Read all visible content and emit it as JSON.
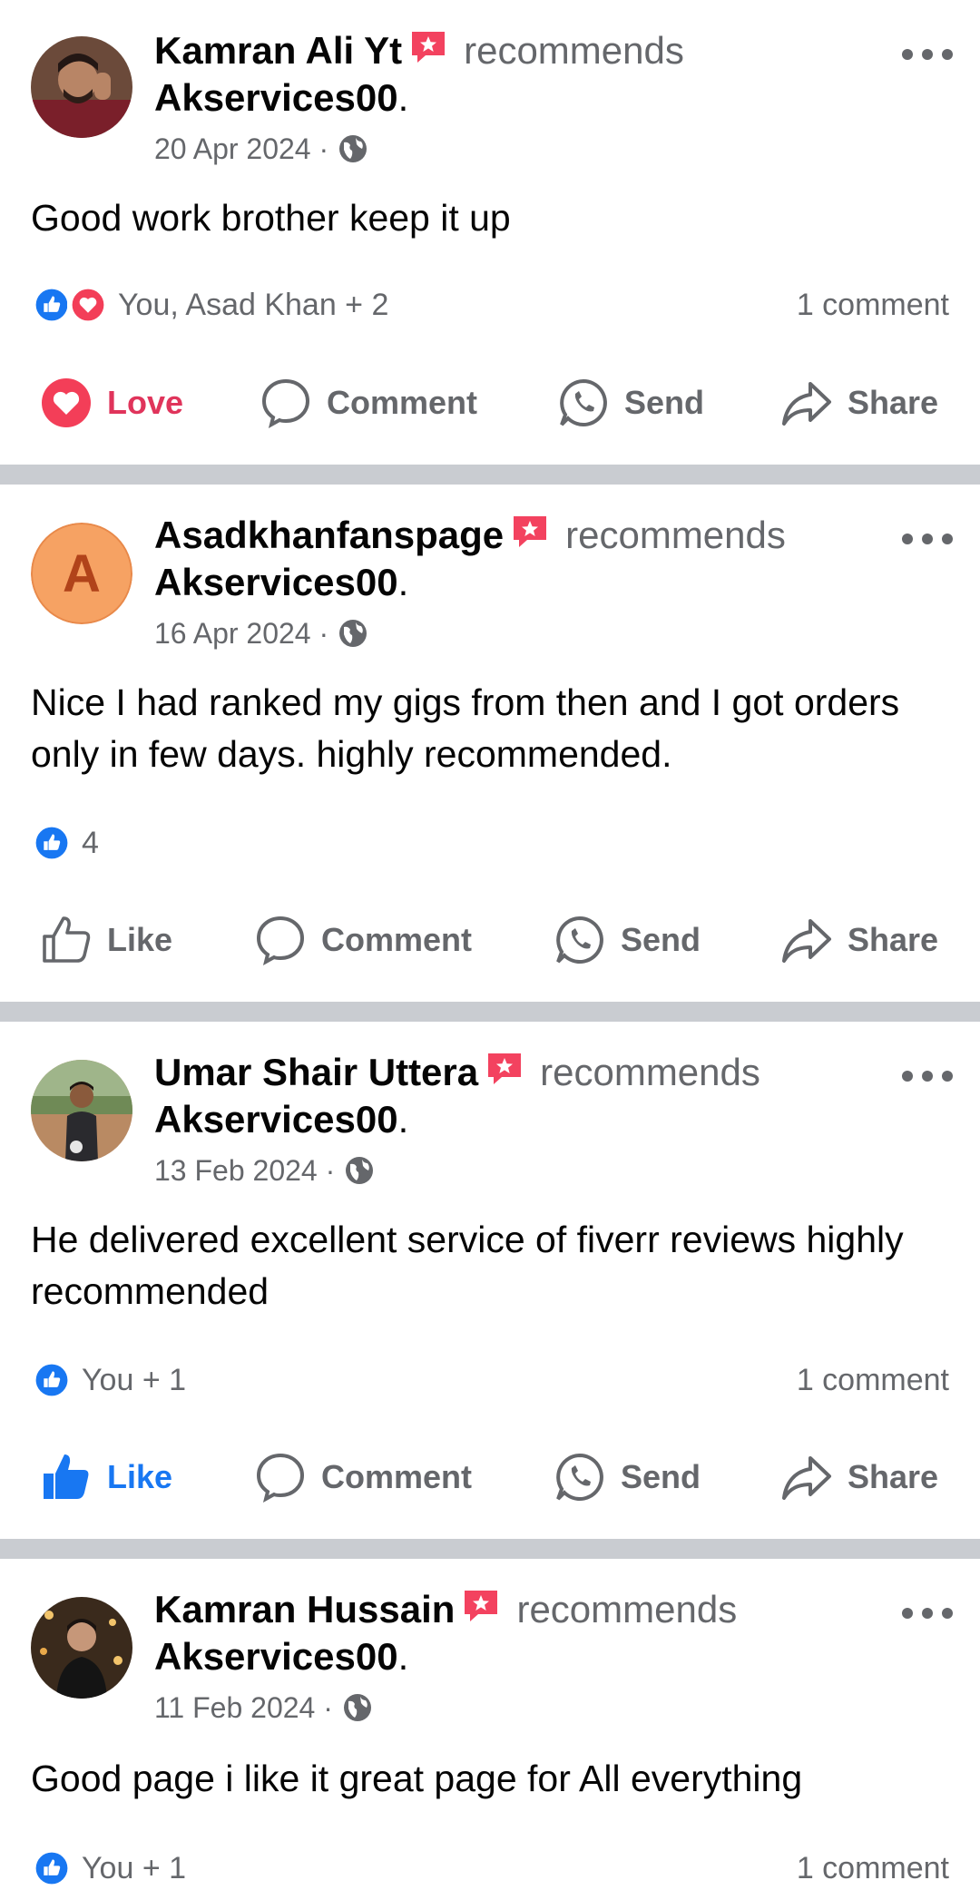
{
  "posts": [
    {
      "author": "Kamran Ali Yt",
      "verb": "recommends",
      "page": "Akservices00",
      "dot": ".",
      "date": "20 Apr 2024 ·",
      "text": "Good work brother keep it up",
      "reactions_text": "You, Asad Khan + 2",
      "comments": "1 comment",
      "actions": [
        "Love",
        "Comment",
        "Send",
        "Share"
      ],
      "avatar": "photo-avatar"
    },
    {
      "author": "Asadkhanfanspage",
      "verb": "recommends",
      "page": "Akservices00",
      "dot": ".",
      "date": "16 Apr 2024 ·",
      "text": "Nice I had ranked my gigs from then and I got orders only in few days. highly recommended.",
      "reactions_text": "4",
      "comments": "",
      "actions": [
        "Like",
        "Comment",
        "Send",
        "Share"
      ],
      "avatar_letter": "A"
    },
    {
      "author": "Umar Shair Uttera",
      "verb": "recommends",
      "page": "Akservices00",
      "dot": ".",
      "date": "13 Feb 2024 ·",
      "text": "He delivered excellent service  of fiverr reviews highly recommended",
      "reactions_text": "You + 1",
      "comments": "1 comment",
      "actions": [
        "Like",
        "Comment",
        "Send",
        "Share"
      ],
      "avatar": "photo-avatar"
    },
    {
      "author": "Kamran Hussain",
      "verb": "recommends",
      "page": "Akservices00",
      "dot": ".",
      "date": "11 Feb 2024 ·",
      "text": "Good page i like it great page for All everything",
      "reactions_text": "You + 1",
      "comments": "1 comment",
      "avatar": "photo-avatar"
    }
  ],
  "colors": {
    "like_blue": "#1877f2",
    "love_red": "#e0345b",
    "secondary_text": "#65676b",
    "separator": "#c9ccd1",
    "recommend_badge": "#f3425f"
  },
  "icons": [
    "recommend-badge-icon",
    "globe-icon",
    "more-icon",
    "like-reaction-icon",
    "love-reaction-icon",
    "comment-icon",
    "send-icon",
    "share-icon",
    "like-icon"
  ]
}
